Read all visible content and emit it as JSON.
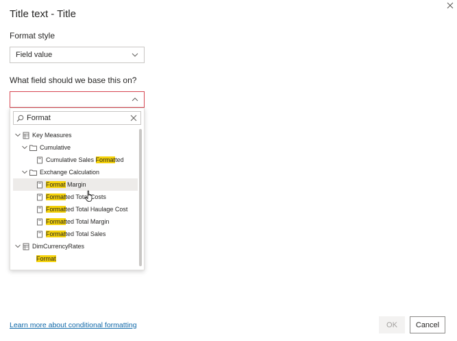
{
  "dialog": {
    "title": "Title text - Title",
    "close_icon": "close-icon"
  },
  "format_style": {
    "label": "Format style",
    "value": "Field value"
  },
  "field": {
    "label": "What field should we base this on?",
    "value": ""
  },
  "search": {
    "value": "Format"
  },
  "tree": [
    {
      "before": "Key Measures",
      "match": "",
      "after": "",
      "icon": "table-icon",
      "expanded": true
    },
    {
      "before": "Cumulative",
      "match": "",
      "after": "",
      "icon": "folder-icon",
      "expanded": true
    },
    {
      "before": "Cumulative Sales ",
      "match": "Format",
      "after": "ted",
      "icon": "measure-icon"
    },
    {
      "before": "Exchange Calculation",
      "match": "",
      "after": "",
      "icon": "folder-icon",
      "expanded": true
    },
    {
      "before": "",
      "match": "Format",
      "after": " Margin",
      "icon": "measure-icon",
      "selected": true
    },
    {
      "before": "",
      "match": "Format",
      "after": "ted Total Costs",
      "icon": "measure-icon"
    },
    {
      "before": "",
      "match": "Format",
      "after": "ted Total Haulage Cost",
      "icon": "measure-icon"
    },
    {
      "before": "",
      "match": "Format",
      "after": "ted Total Margin",
      "icon": "measure-icon"
    },
    {
      "before": "",
      "match": "Format",
      "after": "ted Total Sales",
      "icon": "measure-icon"
    },
    {
      "before": "DimCurrencyRates",
      "match": "",
      "after": "",
      "icon": "table-icon",
      "expanded": true
    },
    {
      "before": "",
      "match": "Format",
      "after": "",
      "icon": "none"
    }
  ],
  "footer": {
    "link": "Learn more about conditional formatting",
    "ok": "OK",
    "cancel": "Cancel"
  },
  "colors": {
    "highlight": "#f5d20a",
    "link": "#0e67a8",
    "error_border": "#d64550"
  }
}
